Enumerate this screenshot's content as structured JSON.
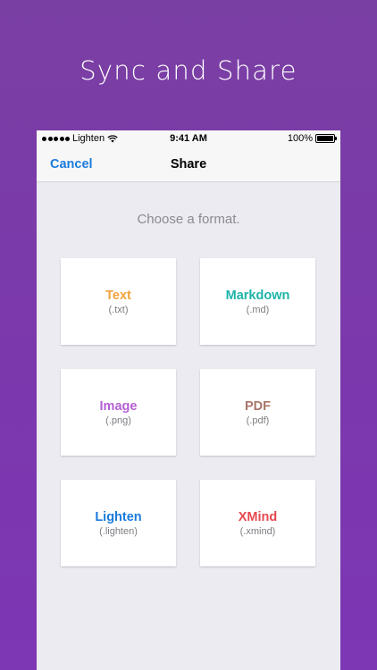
{
  "promo": {
    "title": "Sync and Share"
  },
  "status_bar": {
    "carrier": "Lighten",
    "time": "9:41 AM",
    "battery": "100%"
  },
  "nav": {
    "cancel_label": "Cancel",
    "title": "Share"
  },
  "prompt": "Choose a format.",
  "formats": [
    {
      "name": "Text",
      "ext": "(.txt)",
      "color": "#f0a23c"
    },
    {
      "name": "Markdown",
      "ext": "(.md)",
      "color": "#1cb4a8"
    },
    {
      "name": "Image",
      "ext": "(.png)",
      "color": "#b45fd3"
    },
    {
      "name": "PDF",
      "ext": "(.pdf)",
      "color": "#a8766a"
    },
    {
      "name": "Lighten",
      "ext": "(.lighten)",
      "color": "#1a7bdc"
    },
    {
      "name": "XMind",
      "ext": "(.xmind)",
      "color": "#e5484f"
    }
  ],
  "colors": {
    "background": "#7b38ad",
    "accent": "#1a7bdc"
  },
  "icons": [
    "signal-icon",
    "wifi-icon",
    "battery-icon"
  ]
}
